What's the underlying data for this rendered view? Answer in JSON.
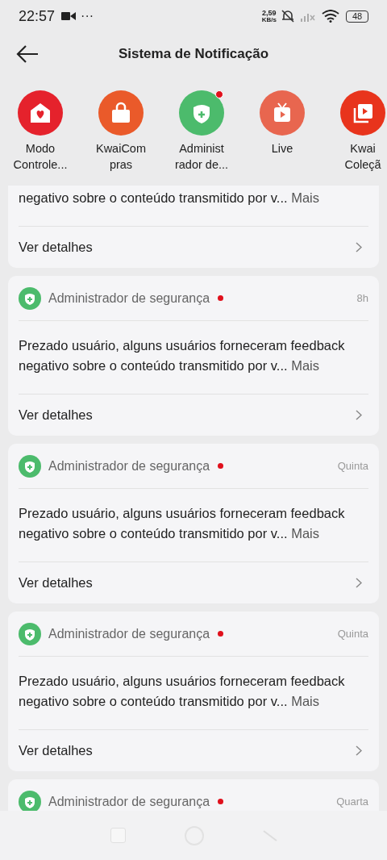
{
  "status_bar": {
    "time": "22:57",
    "more": "···",
    "speed_value": "2,59",
    "speed_unit": "KB/s",
    "battery": "48"
  },
  "header": {
    "title": "Sistema de Notificação"
  },
  "categories": [
    {
      "label_lines": [
        "Modo",
        "Controle..."
      ],
      "kind": "home",
      "color": "#e5222c",
      "unread": false
    },
    {
      "label_lines": [
        "KwaiCom",
        "pras"
      ],
      "kind": "bag",
      "color": "#ea5a2a",
      "unread": false
    },
    {
      "label_lines": [
        "Administ",
        "rador de..."
      ],
      "kind": "shield",
      "color": "#4cbb6c",
      "unread": true
    },
    {
      "label_lines": [
        "Live"
      ],
      "kind": "tv",
      "color": "#e8664f",
      "unread": false
    },
    {
      "label_lines": [
        "Kwai",
        "Coleçã"
      ],
      "kind": "video",
      "color": "#e8341c",
      "unread": false
    }
  ],
  "notifications": [
    {
      "message": "negativo sobre o conteúdo transmitido por v...",
      "more": "Mais",
      "action": "Ver detalhes"
    },
    {
      "sender": "Administrador de segurança",
      "unread": true,
      "time": "8h",
      "message": "Prezado usuário, alguns usuários forneceram feedback negativo sobre o conteúdo transmitido por v...",
      "more": "Mais",
      "action": "Ver detalhes"
    },
    {
      "sender": "Administrador de segurança",
      "unread": true,
      "time": "Quinta",
      "message": "Prezado usuário, alguns usuários forneceram feedback negativo sobre o conteúdo transmitido por v...",
      "more": "Mais",
      "action": "Ver detalhes"
    },
    {
      "sender": "Administrador de segurança",
      "unread": true,
      "time": "Quinta",
      "message": "Prezado usuário, alguns usuários forneceram feedback negativo sobre o conteúdo transmitido por v...",
      "more": "Mais",
      "action": "Ver detalhes"
    },
    {
      "sender": "Administrador de segurança",
      "unread": true,
      "time": "Quarta"
    }
  ]
}
